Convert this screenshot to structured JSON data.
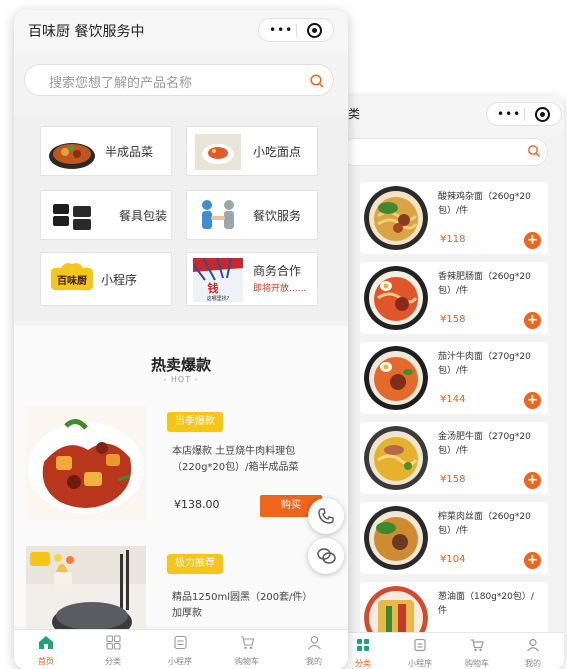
{
  "colors": {
    "accent": "#f0641c",
    "tag": "#f5c518",
    "price": "#e8611b"
  },
  "back_page": {
    "title": "类",
    "capsule": {
      "more": "•••"
    },
    "products": [
      {
        "name": "酸辣鸡杂面（260g*20包）/件",
        "price": "¥118"
      },
      {
        "name": "香辣肥肠面（260g*20包）/件",
        "price": "¥158"
      },
      {
        "name": "茄汁牛肉面（270g*20包）/件",
        "price": "¥144"
      },
      {
        "name": "金汤肥牛面（270g*20包）/件",
        "price": "¥158"
      },
      {
        "name": "榨菜肉丝面（260g*20包）/件",
        "price": "¥104"
      },
      {
        "name": "葱油面（180g*20包）/件",
        "price": ""
      }
    ],
    "tabbar": [
      {
        "label": "分类",
        "icon": "grid-icon"
      },
      {
        "label": "小程序",
        "icon": "miniapp-icon"
      },
      {
        "label": "购物车",
        "icon": "cart-icon"
      },
      {
        "label": "我的",
        "icon": "user-icon"
      }
    ]
  },
  "front_page": {
    "title": "百味厨 餐饮服务中",
    "capsule": {
      "more": "•••"
    },
    "search": {
      "placeholder": "搜索您想了解的产品名称"
    },
    "categories": [
      {
        "label": "半成品菜",
        "icon": "stew-dish-icon"
      },
      {
        "label": "小吃面点",
        "icon": "dumpling-plate-icon"
      },
      {
        "label": "餐具包装",
        "icon": "takeout-boxes-icon"
      },
      {
        "label": "餐饮服务",
        "icon": "handshake-icon"
      },
      {
        "label": "小程序",
        "icon": "brand-logo-icon",
        "logo_text": "百味厨"
      },
      {
        "label": "商务合作",
        "sublabel": "即将开放......",
        "icon": "money-poster-icon",
        "poster_text": "钱",
        "poster_sub": "这哪里找?"
      }
    ],
    "hot": {
      "title": "热卖爆款",
      "subtitle": "- HOT -",
      "items": [
        {
          "tag": "当季爆款",
          "name": "本店爆款 土豆烧牛肉料理包（220g*20包）/箱半成品菜",
          "price": "¥138.00",
          "button": "购买"
        },
        {
          "tag": "极力推荐",
          "name": "精品1250ml圆黑（200套/件）加厚款",
          "price": "",
          "button": ""
        }
      ]
    },
    "tabbar": [
      {
        "label": "首页",
        "icon": "home-icon"
      },
      {
        "label": "分类",
        "icon": "grid-icon"
      },
      {
        "label": "小程序",
        "icon": "miniapp-icon"
      },
      {
        "label": "购物车",
        "icon": "cart-icon"
      },
      {
        "label": "我的",
        "icon": "user-icon"
      }
    ]
  }
}
